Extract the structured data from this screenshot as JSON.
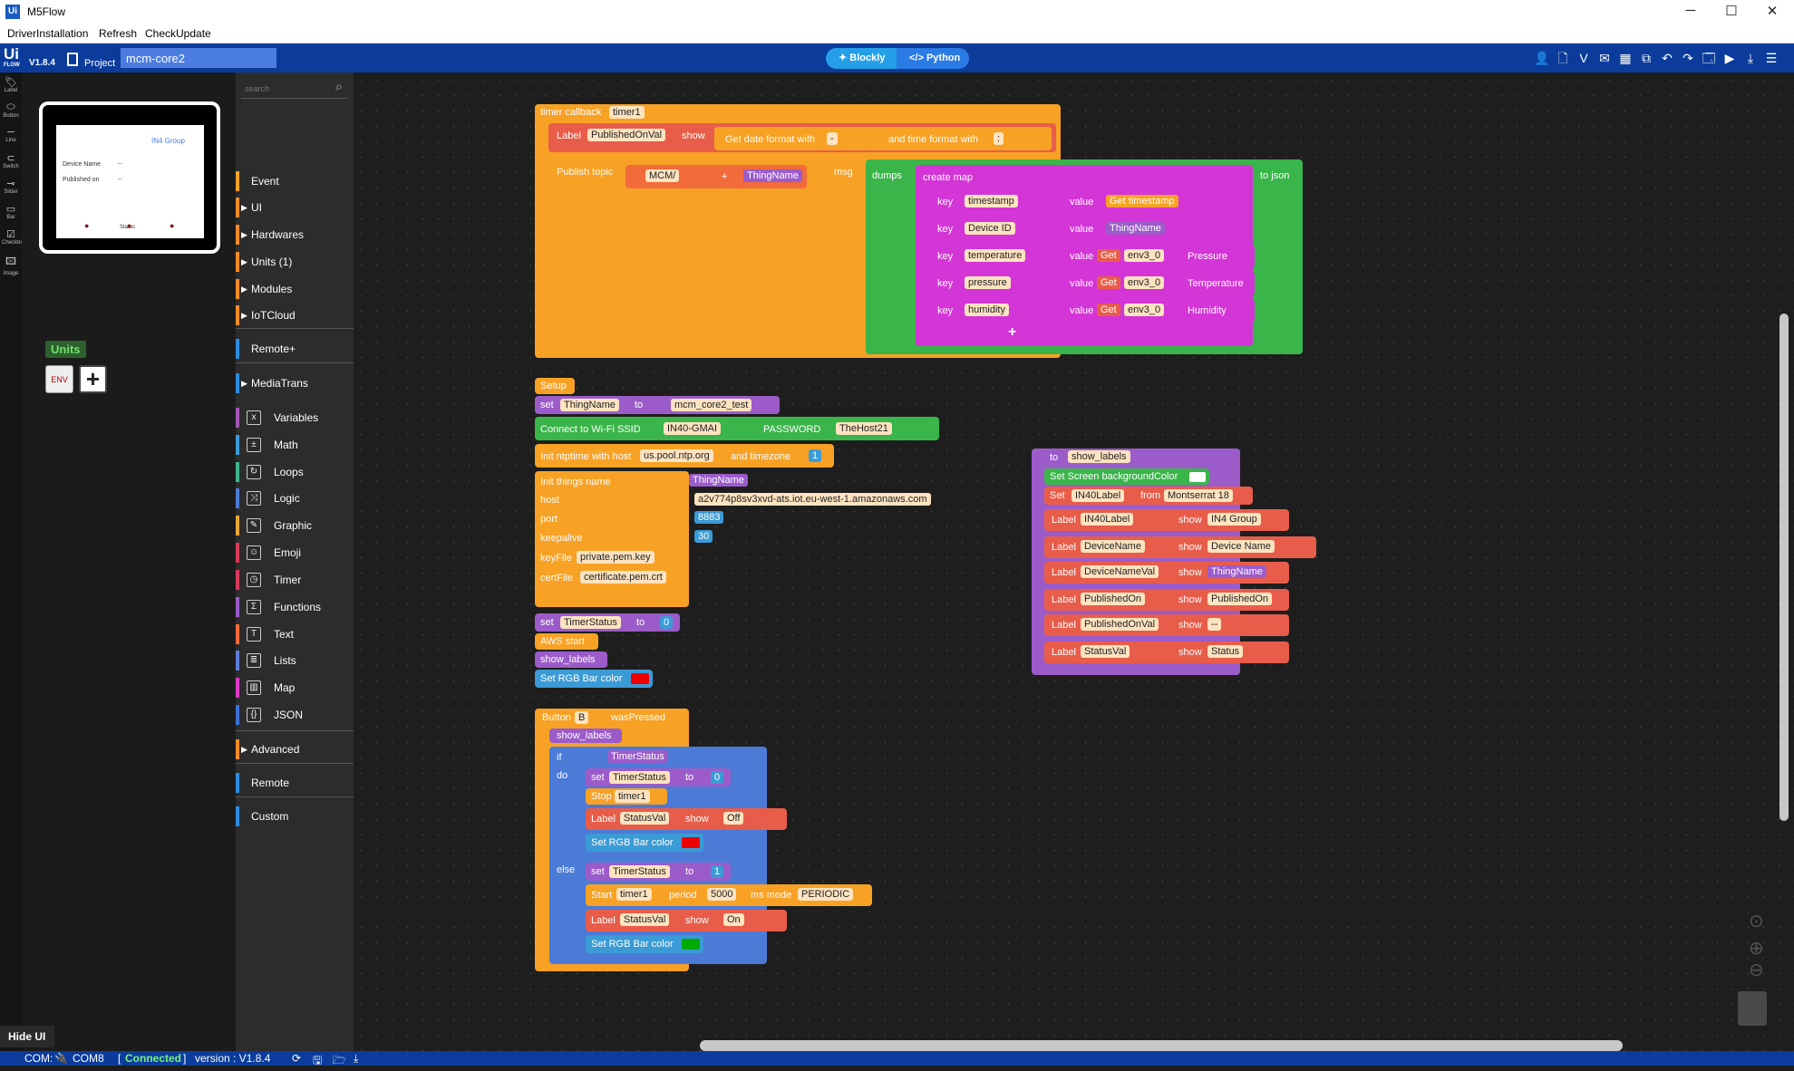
{
  "app": {
    "title": "M5Flow",
    "version": "V1.8.4",
    "logo": "Ui",
    "logo_sub": "FLOW"
  },
  "menu": [
    "DriverInstallation",
    "Refresh",
    "CheckUpdate"
  ],
  "window_controls": {
    "minimize": "─",
    "maximize": "☐",
    "close": "✕"
  },
  "toolbar": {
    "project_label": "Project",
    "project_name": "mcm-core2",
    "mode_blockly": "Blockly",
    "mode_python": "Python",
    "icons": [
      "user-icon",
      "new-file-icon",
      "version-icon",
      "mail-icon",
      "example-icon",
      "remote-icon",
      "undo-icon",
      "redo-icon",
      "preview-icon",
      "run-icon",
      "download-icon",
      "menu-icon"
    ]
  },
  "icon_glyphs": {
    "user-icon": "👤",
    "new-file-icon": "🗋",
    "version-icon": "V",
    "mail-icon": "✉",
    "example-icon": "▦",
    "remote-icon": "⧉",
    "undo-icon": "↶",
    "redo-icon": "↷",
    "preview-icon": "🗔",
    "run-icon": "▶",
    "download-icon": "⤓",
    "menu-icon": "☰"
  },
  "left_strip": [
    {
      "name": "Label",
      "glyph": "🏷"
    },
    {
      "name": "Button",
      "glyph": "⬭"
    },
    {
      "name": "Line",
      "glyph": "─"
    },
    {
      "name": "Switch",
      "glyph": "⊂"
    },
    {
      "name": "Slider",
      "glyph": "⊸"
    },
    {
      "name": "Bar",
      "glyph": "▭"
    },
    {
      "name": "Checkbox",
      "glyph": "☑"
    },
    {
      "name": "Image",
      "glyph": "🖾"
    }
  ],
  "device_screen": {
    "title": "IN4 Group",
    "device_name_label": "Device Name",
    "device_name_value": "--",
    "published_label": "Published on",
    "published_value": "--",
    "status": "Status",
    "btn_glyph": "●"
  },
  "units_label": "Units",
  "unit_env": "ENV",
  "unit_add": "+",
  "toolbox": {
    "search_placeholder": "search",
    "categories": [
      {
        "label": "Event",
        "color": "#f7a125",
        "arrow": ""
      },
      {
        "label": "UI",
        "color": "#f48a2a",
        "arrow": "▶"
      },
      {
        "label": "Hardwares",
        "color": "#f48a2a",
        "arrow": "▶"
      },
      {
        "label": "Units (1)",
        "color": "#f48a2a",
        "arrow": "▶"
      },
      {
        "label": "Modules",
        "color": "#f48a2a",
        "arrow": "▶"
      },
      {
        "label": "IoTCloud",
        "color": "#f48a2a",
        "arrow": "▶"
      },
      {
        "label": "Remote+",
        "color": "#2b8de0",
        "arrow": ""
      },
      {
        "label": "MediaTrans",
        "color": "#2b8de0",
        "arrow": "▶"
      },
      {
        "label": "Variables",
        "color": "#a455b5",
        "icon": "x"
      },
      {
        "label": "Math",
        "color": "#3b9bd6",
        "icon": "±"
      },
      {
        "label": "Loops",
        "color": "#40b58a",
        "icon": "↻"
      },
      {
        "label": "Logic",
        "color": "#4b7bd6",
        "icon": "⤨"
      },
      {
        "label": "Graphic",
        "color": "#e7a63a",
        "icon": "✎"
      },
      {
        "label": "Emoji",
        "color": "#d6395a",
        "icon": "☺"
      },
      {
        "label": "Timer",
        "color": "#d6395a",
        "icon": "◷"
      },
      {
        "label": "Functions",
        "color": "#9b5cc9",
        "icon": "Σ"
      },
      {
        "label": "Text",
        "color": "#f26b3a",
        "icon": "T"
      },
      {
        "label": "Lists",
        "color": "#5b7cd6",
        "icon": "≣"
      },
      {
        "label": "Map",
        "color": "#e03ac8",
        "icon": "▥"
      },
      {
        "label": "JSON",
        "color": "#3a6fd6",
        "icon": "{}"
      },
      {
        "label": "Advanced",
        "color": "#f48a2a",
        "arrow": "▶"
      },
      {
        "label": "Remote",
        "color": "#2b8de0",
        "arrow": ""
      },
      {
        "label": "Custom",
        "color": "#2b8de0",
        "arrow": ""
      }
    ]
  },
  "hide_ui": "Hide UI",
  "status": {
    "com": "COM:",
    "port": "COM8",
    "conn_open": "[",
    "connected": "Connected",
    "conn_close": "]",
    "version": "version : V1.8.4"
  },
  "blocks": {
    "timer": {
      "hdr": "timer callback",
      "timer": "timer1",
      "label_kw": "Label",
      "label_name": "PublishedOnVal",
      "show": "show",
      "date_fmt": "Get date format with",
      "date_sep": "-",
      "time_fmt": "and time format with",
      "time_sep": ":",
      "publish": "Publish topic",
      "topic": "MCM/",
      "plus": "+",
      "thing": "ThingName",
      "msg": "msg",
      "dumps": "dumps",
      "create_map": "create map",
      "to_json": "to json",
      "key": "key",
      "value": "value",
      "rows": [
        {
          "k": "timestamp",
          "v": "Get timestamp"
        },
        {
          "k": "Device ID",
          "v": "ThingName"
        },
        {
          "k": "temperature",
          "get": "Get",
          "obj": "env3_0",
          "v": "Pressure"
        },
        {
          "k": "pressure",
          "get": "Get",
          "obj": "env3_0",
          "v": "Temperature"
        },
        {
          "k": "humidity",
          "get": "Get",
          "obj": "env3_0",
          "v": "Humidity"
        }
      ]
    },
    "setup": {
      "hdr": "Setup",
      "set": "set",
      "var": "ThingName",
      "to": "to",
      "val": "mcm_core2_test",
      "wifi": "Connect to Wi-Fi SSID",
      "ssid": "IN40-GMAI",
      "pwd_kw": "PASSWORD",
      "pwd": "TheHost21",
      "ntp": "Init ntptime with host",
      "ntp_host": "us.pool.ntp.org",
      "tz_kw": "and timezone",
      "tz": "1",
      "things": "Init things name",
      "things_val": "ThingName",
      "host_kw": "host",
      "host": "a2v774p8sv3xvd-ats.iot.eu-west-1.amazonaws.com",
      "port_kw": "port",
      "port": "8883",
      "keep_kw": "keepalive",
      "keep": "30",
      "keyf_kw": "keyFile",
      "keyf": "private.pem.key",
      "cert_kw": "certFile",
      "cert": "certificate.pem.crt",
      "set2": "set",
      "var2": "TimerStatus",
      "to2": "to",
      "val2": "0",
      "aws": "AWS start",
      "show_labels": "show_labels",
      "rgb": "Set RGB Bar color"
    },
    "func": {
      "to": "to",
      "name": "show_labels",
      "bg": "Set Screen backgroundColor",
      "set": "Set",
      "obj": "IN40Label",
      "from": "from",
      "font": "Montserrat 18",
      "rows": [
        {
          "lbl": "Label",
          "n": "IN40Label",
          "show": "show",
          "v": "IN4 Group"
        },
        {
          "lbl": "Label",
          "n": "DeviceName",
          "show": "show",
          "v": "Device Name"
        },
        {
          "lbl": "Label",
          "n": "DeviceNameVal",
          "show": "show",
          "v": "ThingName"
        },
        {
          "lbl": "Label",
          "n": "PublishedOn",
          "show": "show",
          "v": "PublishedOn"
        },
        {
          "lbl": "Label",
          "n": "PublishedOnVal",
          "show": "show",
          "v": "--"
        },
        {
          "lbl": "Label",
          "n": "StatusVal",
          "show": "show",
          "v": "Status"
        }
      ]
    },
    "button": {
      "hdr": "Button",
      "btn": "B",
      "evt": "wasPressed",
      "show_labels": "show_labels",
      "if": "if",
      "cond": "TimerStatus",
      "do": "do",
      "set": "set",
      "var": "TimerStatus",
      "to": "to",
      "v0": "0",
      "stop": "Stop",
      "timer": "timer1",
      "lbl": "Label",
      "lname": "StatusVal",
      "show": "show",
      "off": "Off",
      "rgb": "Set RGB Bar color",
      "else": "else",
      "v1": "1",
      "start": "Start",
      "period": "period",
      "per": "5000",
      "mode": "ms mode",
      "periodic": "PERIODIC",
      "on": "On"
    }
  },
  "colors": {
    "blue": "#0b3c9c",
    "orange": "#f7a125",
    "green": "#3ab54a",
    "magenta": "#d435d6",
    "func": "#9b5cc9",
    "label": "#e85d4a"
  }
}
